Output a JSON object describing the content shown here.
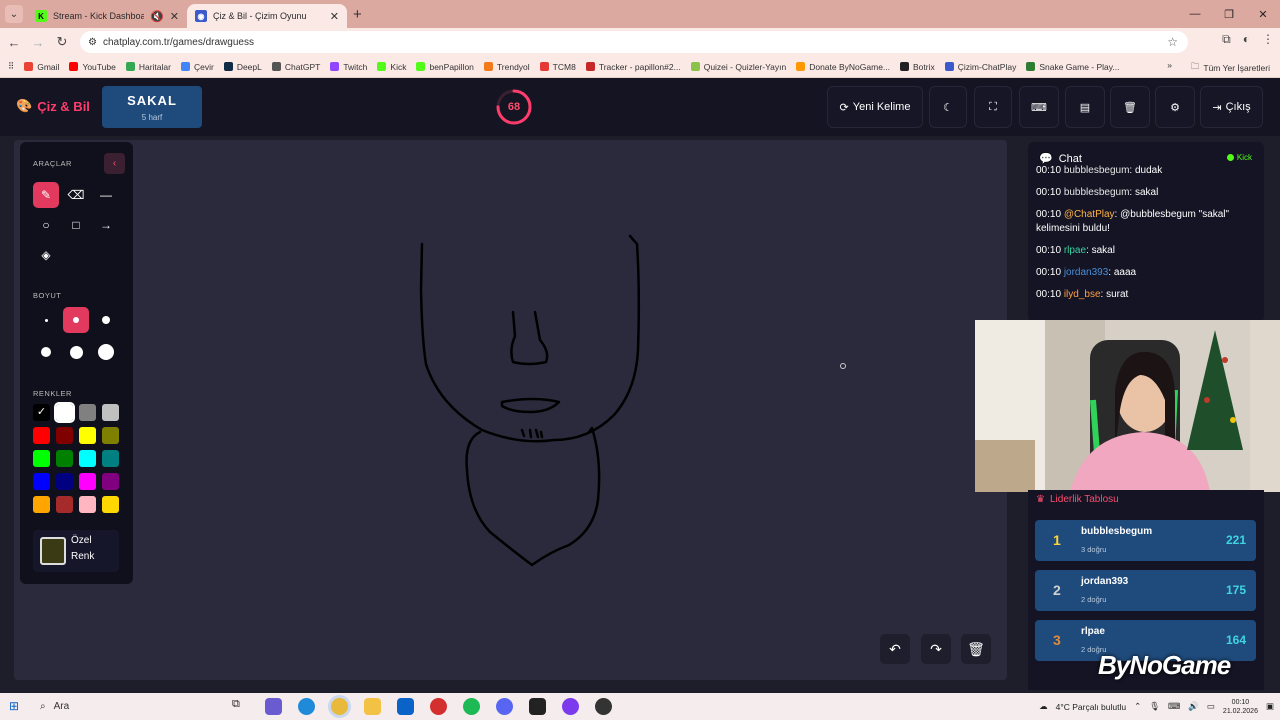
{
  "browser": {
    "tabs": [
      {
        "title": "Stream - Kick Dashboard",
        "active": false,
        "icon": "kick-icon"
      },
      {
        "title": "Çiz & Bil - Çizim Oyunu",
        "active": true,
        "icon": "gamepad-icon"
      }
    ],
    "url": "chatplay.com.tr/games/drawguess",
    "bookmarks": [
      "Gmail",
      "YouTube",
      "Haritalar",
      "Çevir",
      "DeepL",
      "ChatGPT",
      "Twitch",
      "Kick",
      "benPapillon",
      "Trendyol",
      "TCM8",
      "Tracker - papillon#2...",
      "Quizei - Quizler-Yayın",
      "Donate ByNoGame...",
      "Botrix",
      "Çizim-ChatPlay",
      "Snake Game - Play..."
    ],
    "all_bookmarks": "Tüm Yer İşaretleri"
  },
  "header": {
    "logo": "Çiz & Bil",
    "word": "SAKAL",
    "word_length": "5 harf",
    "timer": "68",
    "timer_fraction": 0.75,
    "new_word": "Yeni Kelime",
    "exit": "Çıkış"
  },
  "tools": {
    "section_tools": "ARAÇLAR",
    "section_size": "BOYUT",
    "section_colors": "RENKLER",
    "custom_color_line1": "Özel",
    "custom_color_line2": "Renk",
    "colors": [
      "#000000",
      "#ffffff",
      "#808080",
      "#c0c0c0",
      "#ff0000",
      "#800000",
      "#ffff00",
      "#808000",
      "#00ff00",
      "#008000",
      "#00ffff",
      "#008080",
      "#0000ff",
      "#000080",
      "#ff00ff",
      "#800080",
      "#ffa500",
      "#a52a2a",
      "#ffb6c1",
      "#ffd700"
    ],
    "custom_color": "#3a3a14"
  },
  "chat": {
    "title": "Chat",
    "platform": "Kick",
    "messages": [
      {
        "time": "00:10",
        "user": "bubblesbegum",
        "text": ": dudak",
        "color": "#e6e6e6"
      },
      {
        "time": "00:10",
        "user": "bubblesbegum",
        "text": ": sakal",
        "color": "#e6e6e6"
      },
      {
        "time": "00:10",
        "user": "@ChatPlay",
        "text": ": @bubblesbegum \"sakal\" kelimesini buldu!",
        "color": "#ffb347"
      },
      {
        "time": "00:10",
        "user": "rlpae",
        "text": ": sakal",
        "color": "#3ad29f"
      },
      {
        "time": "00:10",
        "user": "jordan393",
        "text": ": aaaa",
        "color": "#4a8fd8"
      },
      {
        "time": "00:10",
        "user": "ilyd_bse",
        "text": ": surat",
        "color": "#ff9f43"
      }
    ]
  },
  "leaderboard": {
    "title": "Liderlik Tablosu",
    "rows": [
      {
        "rank": "1",
        "name": "bubblesbegum",
        "sub": "3 doğru",
        "score": "221",
        "rank_color": "#ffd43b"
      },
      {
        "rank": "2",
        "name": "jordan393",
        "sub": "2 doğru",
        "score": "175",
        "rank_color": "#d0d0d0"
      },
      {
        "rank": "3",
        "name": "rlpae",
        "sub": "2 doğru",
        "score": "164",
        "rank_color": "#e0893d"
      }
    ]
  },
  "overlay_brand": "ByNoGame",
  "taskbar": {
    "search": "Ara",
    "weather": "4°C  Parçalı bulutlu",
    "time": "00:10",
    "date": "21.02.2026"
  }
}
